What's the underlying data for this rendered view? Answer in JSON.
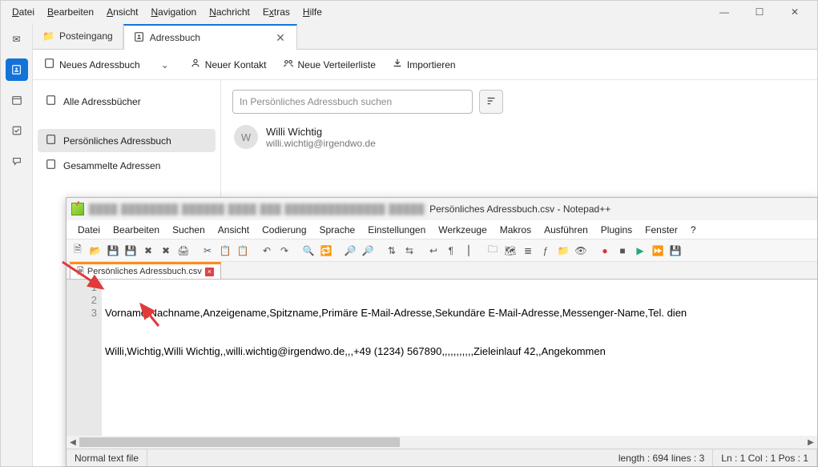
{
  "tb": {
    "menu": [
      "Datei",
      "Bearbeiten",
      "Ansicht",
      "Navigation",
      "Nachricht",
      "Extras",
      "Hilfe"
    ],
    "tabs": {
      "inbox": "Posteingang",
      "addr": "Adressbuch"
    },
    "toolbar": {
      "new_ab": "Neues Adressbuch",
      "new_contact": "Neuer Kontakt",
      "new_list": "Neue Verteilerliste",
      "import": "Importieren"
    },
    "sidebar": {
      "all": "Alle Adressbücher",
      "personal": "Persönliches Adressbuch",
      "collected": "Gesammelte Adressen"
    },
    "search_placeholder": "In Persönliches Adressbuch suchen",
    "contact": {
      "name": "Willi Wichtig",
      "email": "willi.wichtig@irgendwo.de",
      "initial": "W"
    }
  },
  "npp": {
    "title_suffix": "Persönliches Adressbuch.csv - Notepad++",
    "menu": [
      "Datei",
      "Bearbeiten",
      "Suchen",
      "Ansicht",
      "Codierung",
      "Sprache",
      "Einstellungen",
      "Werkzeuge",
      "Makros",
      "Ausführen",
      "Plugins",
      "Fenster",
      "?"
    ],
    "doc_tab": "Persönliches Adressbuch.csv",
    "lines": [
      "Vorname,Nachname,Anzeigename,Spitzname,Primäre E-Mail-Adresse,Sekundäre E-Mail-Adresse,Messenger-Name,Tel. dien",
      "Willi,Wichtig,Willi Wichtig,,willi.wichtig@irgendwo.de,,,+49 (1234) 567890,,,,,,,,,,,Zieleinlauf 42,,Angekommen",
      ""
    ],
    "line_numbers": [
      "1",
      "2",
      "3"
    ],
    "status": {
      "mode": "Normal text file",
      "length": "length : 694    lines : 3",
      "pos": "Ln : 1    Col : 1    Pos : 1"
    }
  }
}
